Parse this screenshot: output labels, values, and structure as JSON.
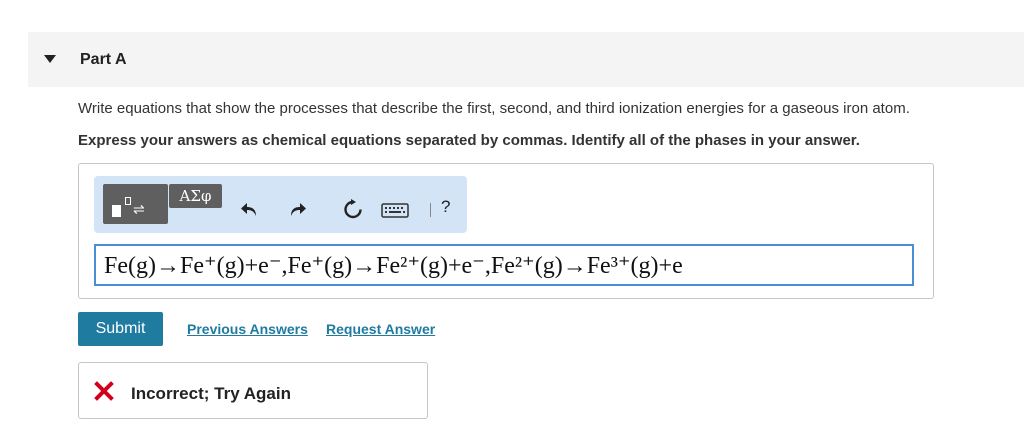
{
  "part": {
    "title": "Part A"
  },
  "question": "Write equations that show the processes that describe the first, second, and third ionization energies for a gaseous iron atom.",
  "instruction": "Express your answers as chemical equations separated by commas. Identify all of the phases in your answer.",
  "toolbar": {
    "greek_label": "ΑΣφ",
    "help_label": "?",
    "icons": [
      "templates-icon",
      "greek-symbols-icon",
      "undo-icon",
      "redo-icon",
      "reset-icon",
      "keyboard-icon",
      "help-icon"
    ]
  },
  "answer": {
    "equation": "Fe(g)→Fe⁺(g)+e⁻,Fe⁺(g)→Fe²⁺(g)+e⁻,Fe²⁺(g)→Fe³⁺(g)+e"
  },
  "actions": {
    "submit_label": "Submit",
    "previous_answers_label": "Previous Answers",
    "request_answer_label": "Request Answer"
  },
  "feedback": {
    "status": "Incorrect; Try Again"
  },
  "colors": {
    "accent": "#1f7ba0",
    "toolbar_bg": "#d4e4f7",
    "error": "#d0021b",
    "input_border": "#4a8fd6"
  }
}
